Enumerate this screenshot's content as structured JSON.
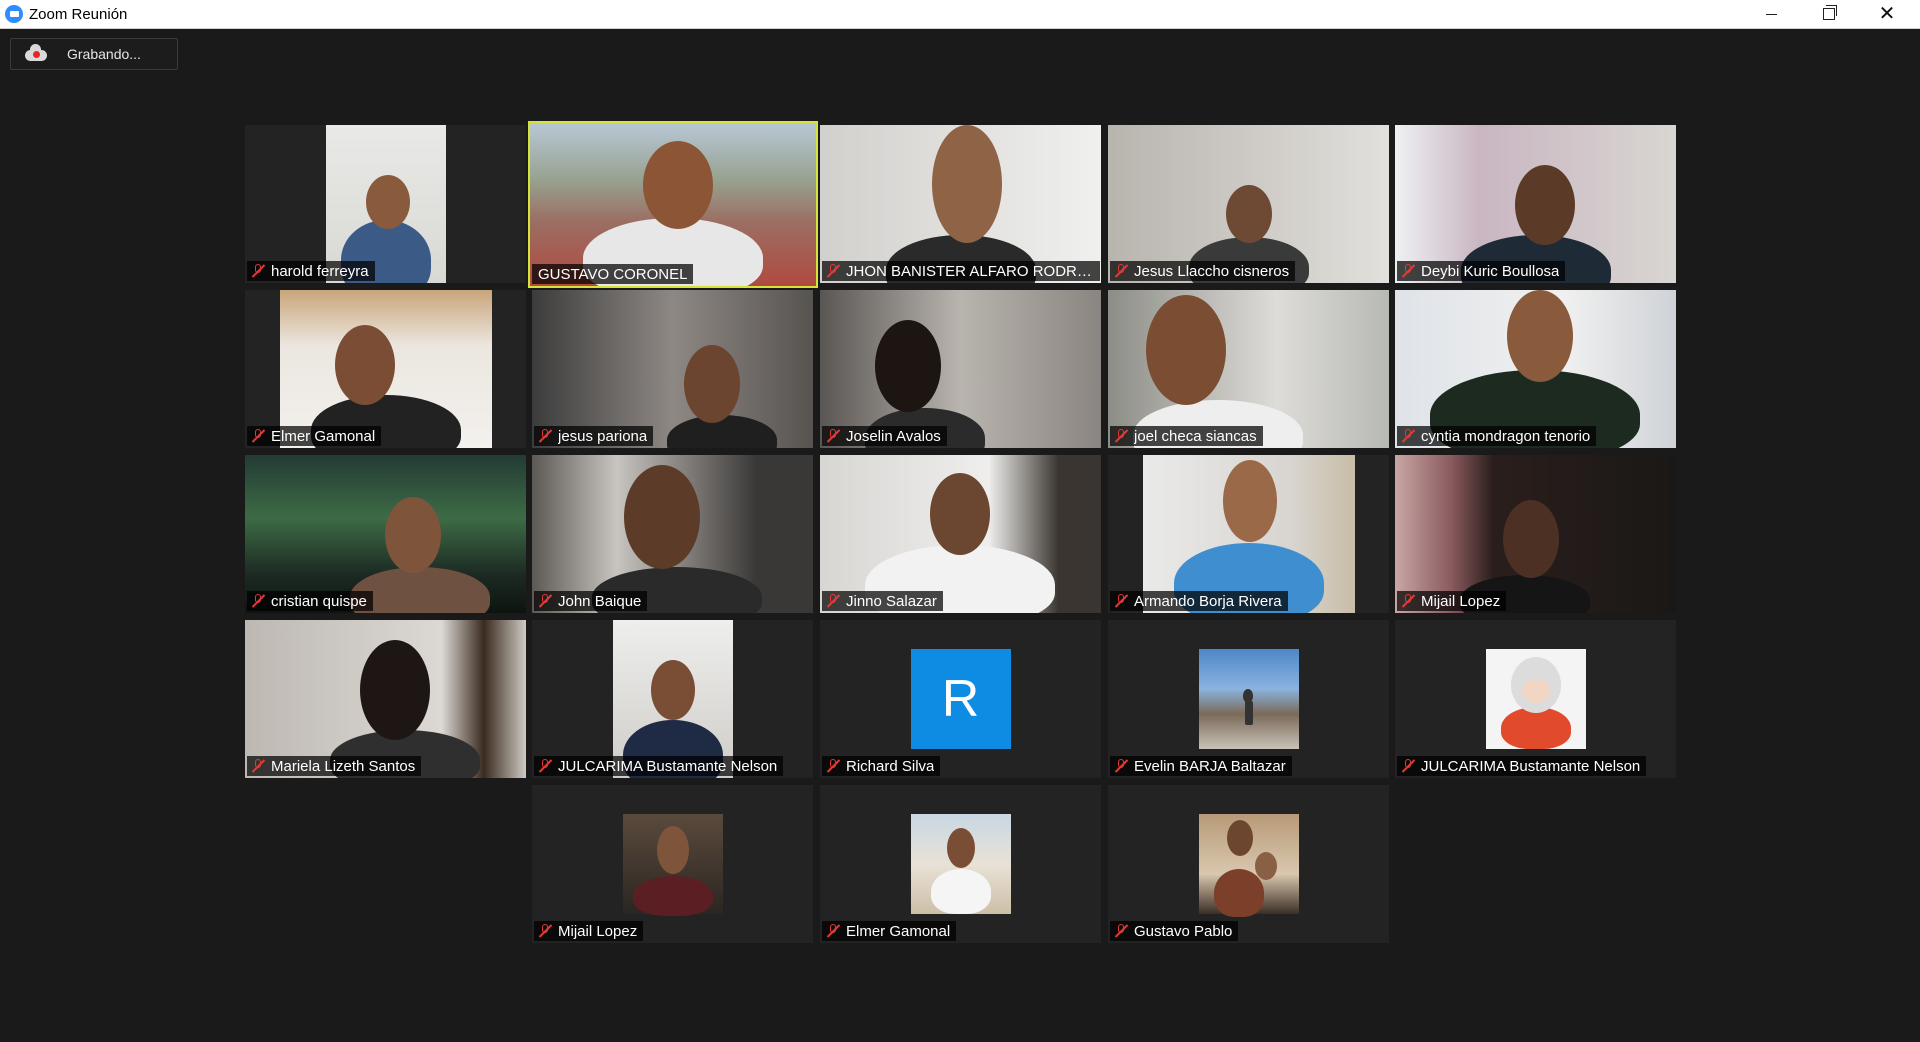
{
  "window": {
    "title": "Zoom Reunión"
  },
  "recording": {
    "label": "Grabando..."
  },
  "participants": [
    {
      "name": "harold ferreyra",
      "muted": true
    },
    {
      "name": "GUSTAVO CORONEL",
      "muted": false,
      "active_speaker": true
    },
    {
      "name": "JHON BANISTER ALFARO RODRIG...",
      "muted": true
    },
    {
      "name": "Jesus Llaccho cisneros",
      "muted": true
    },
    {
      "name": "Deybi Kuric Boullosa",
      "muted": true
    },
    {
      "name": "Elmer Gamonal",
      "muted": true
    },
    {
      "name": "jesus pariona",
      "muted": true
    },
    {
      "name": "Joselin Avalos",
      "muted": true
    },
    {
      "name": "joel checa siancas",
      "muted": true
    },
    {
      "name": "cyntia mondragon tenorio",
      "muted": true
    },
    {
      "name": "cristian quispe",
      "muted": true
    },
    {
      "name": "John Baique",
      "muted": true
    },
    {
      "name": "Jinno Salazar",
      "muted": true
    },
    {
      "name": "Armando Borja Rivera",
      "muted": true
    },
    {
      "name": "Mijail Lopez",
      "muted": true
    },
    {
      "name": "Mariela Lizeth Santos",
      "muted": true
    },
    {
      "name": "JULCARIMA Bustamante Nelson",
      "muted": true
    },
    {
      "name": "Richard Silva",
      "muted": true,
      "avatar_letter": "R"
    },
    {
      "name": "Evelin BARJA  Baltazar",
      "muted": true
    },
    {
      "name": "JULCARIMA Bustamante Nelson",
      "muted": true
    },
    {
      "name": "Mijail Lopez",
      "muted": true
    },
    {
      "name": "Elmer Gamonal",
      "muted": true
    },
    {
      "name": "Gustavo Pablo",
      "muted": true
    }
  ],
  "colors": {
    "active_border": "#d6e43a",
    "muted_icon": "#e53935",
    "avatar_blue": "#0e8ce4"
  }
}
